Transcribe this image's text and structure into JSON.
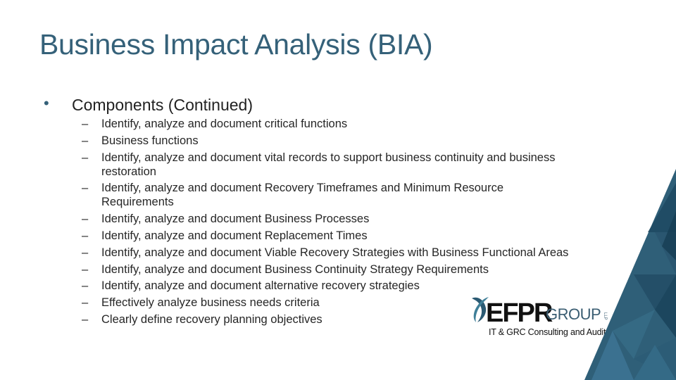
{
  "slide": {
    "title": "Business Impact Analysis (BIA)",
    "bullet": {
      "marker": "•",
      "text": "Components (Continued)"
    },
    "sub_marker": "–",
    "sub_items": [
      {
        "text": "Identify, analyze and document critical functions"
      },
      {
        "text": "Business functions"
      },
      {
        "text": "Identify, analyze and document vital records to support business continuity and business restoration"
      },
      {
        "text": "Identify, analyze and document Recovery Timeframes and Minimum Resource Requirements"
      },
      {
        "text": "Identify, analyze and document Business Processes"
      },
      {
        "text": "Identify, analyze and document Replacement Times"
      },
      {
        "text": "Identify, analyze and document Viable Recovery Strategies with Business Functional Areas"
      },
      {
        "text": "Identify, analyze and document Business Continuity Strategy Requirements"
      },
      {
        "text": "Identify, analyze and document alternative recovery strategies"
      },
      {
        "text": "Effectively analyze business needs criteria"
      },
      {
        "text": "Clearly define recovery planning objectives"
      }
    ]
  },
  "logo": {
    "brand": "EFPR",
    "group": "GROUP",
    "suffix": "LLP",
    "tagline": "IT & GRC Consulting and Audit"
  },
  "colors": {
    "title": "#356179",
    "accent": "#2b5a73",
    "text": "#262626"
  }
}
